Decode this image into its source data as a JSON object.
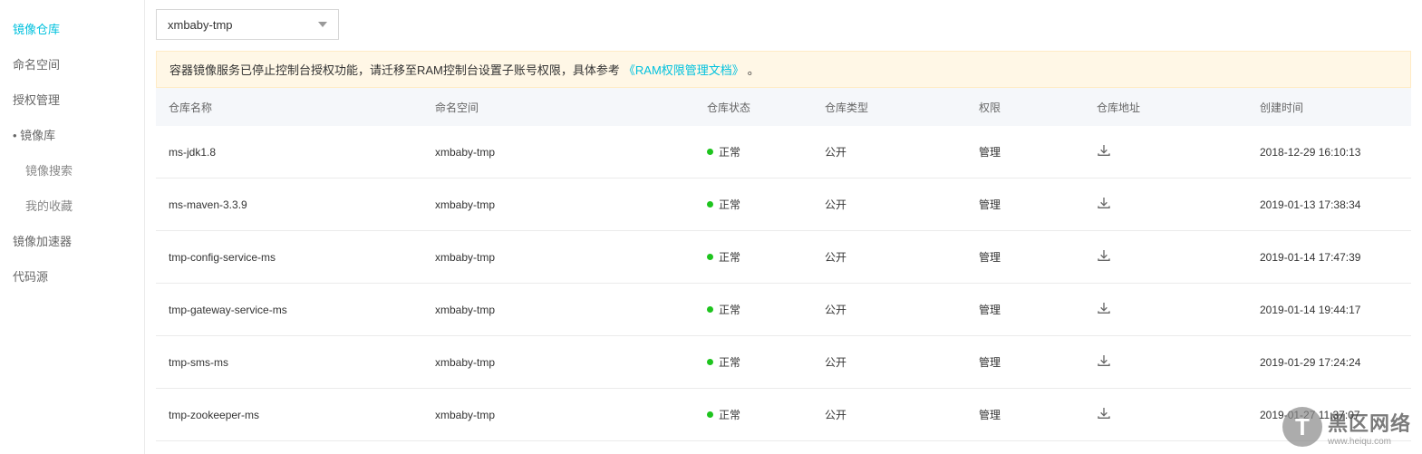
{
  "sidebar": {
    "items": [
      {
        "label": "镜像仓库",
        "active": true
      },
      {
        "label": "命名空间"
      },
      {
        "label": "授权管理"
      },
      {
        "label": "镜像库",
        "bullet": true
      },
      {
        "label": "镜像搜索",
        "sub": true
      },
      {
        "label": "我的收藏",
        "sub": true
      },
      {
        "label": "镜像加速器"
      },
      {
        "label": "代码源"
      }
    ]
  },
  "dropdown": {
    "value": "xmbaby-tmp"
  },
  "warning": {
    "text_before": "容器镜像服务已停止控制台授权功能，请迁移至RAM控制台设置子账号权限，具体参考",
    "link": "《RAM权限管理文档》",
    "text_after": "。"
  },
  "table": {
    "headers": {
      "name": "仓库名称",
      "namespace": "命名空间",
      "status": "仓库状态",
      "type": "仓库类型",
      "perm": "权限",
      "addr": "仓库地址",
      "time": "创建时间"
    },
    "rows": [
      {
        "name": "ms-jdk1.8",
        "namespace": "xmbaby-tmp",
        "status": "正常",
        "type": "公开",
        "perm": "管理",
        "time": "2018-12-29 16:10:13"
      },
      {
        "name": "ms-maven-3.3.9",
        "namespace": "xmbaby-tmp",
        "status": "正常",
        "type": "公开",
        "perm": "管理",
        "time": "2019-01-13 17:38:34"
      },
      {
        "name": "tmp-config-service-ms",
        "namespace": "xmbaby-tmp",
        "status": "正常",
        "type": "公开",
        "perm": "管理",
        "time": "2019-01-14 17:47:39"
      },
      {
        "name": "tmp-gateway-service-ms",
        "namespace": "xmbaby-tmp",
        "status": "正常",
        "type": "公开",
        "perm": "管理",
        "time": "2019-01-14 19:44:17"
      },
      {
        "name": "tmp-sms-ms",
        "namespace": "xmbaby-tmp",
        "status": "正常",
        "type": "公开",
        "perm": "管理",
        "time": "2019-01-29 17:24:24"
      },
      {
        "name": "tmp-zookeeper-ms",
        "namespace": "xmbaby-tmp",
        "status": "正常",
        "type": "公开",
        "perm": "管理",
        "time": "2019-01-27 11:37:07"
      }
    ]
  },
  "watermark": {
    "main": "黑区网络",
    "sub": "www.heiqu.com"
  }
}
